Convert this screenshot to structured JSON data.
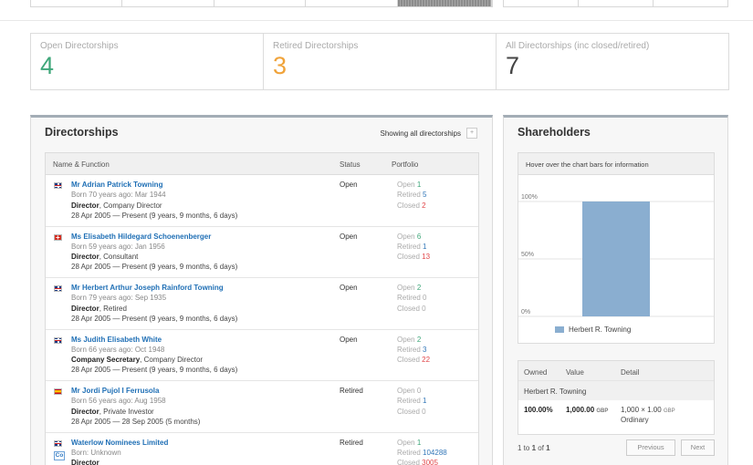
{
  "stats": [
    {
      "label": "Open Directorships",
      "value": "4",
      "color": "#3fa77a"
    },
    {
      "label": "Retired Directorships",
      "value": "3",
      "color": "#f0a33a"
    },
    {
      "label": "All Directorships (inc closed/retired)",
      "value": "7",
      "color": "#444444"
    }
  ],
  "directorships": {
    "title": "Directorships",
    "showing": "Showing all directorships",
    "showing_btn": "+",
    "columns": {
      "name": "Name & Function",
      "status": "Status",
      "portfolio": "Portfolio"
    },
    "rows": [
      {
        "flag": "uk",
        "name": "Mr Adrian Patrick Towning",
        "born": "Born 70 years ago: Mar 1944",
        "role": "Director",
        "occupation": ", Company Director",
        "dates": "28 Apr 2005 — Present (9 years, 9 months, 6 days)",
        "status": "Open",
        "open_label": "Open",
        "open": "1",
        "retired_label": "Retired",
        "retired": "5",
        "closed_label": "Closed",
        "closed": "2"
      },
      {
        "flag": "ch",
        "name": "Ms Elisabeth Hildegard Schoenenberger",
        "born": "Born 59 years ago: Jan 1956",
        "role": "Director",
        "occupation": ", Consultant",
        "dates": "28 Apr 2005 — Present (9 years, 9 months, 6 days)",
        "status": "Open",
        "open_label": "Open",
        "open": "6",
        "retired_label": "Retired",
        "retired": "1",
        "closed_label": "Closed",
        "closed": "13"
      },
      {
        "flag": "uk",
        "name": "Mr Herbert Arthur Joseph Rainford Towning",
        "born": "Born 79 years ago: Sep 1935",
        "role": "Director",
        "occupation": ", Retired",
        "dates": "28 Apr 2005 — Present (9 years, 9 months, 6 days)",
        "status": "Open",
        "open_label": "Open",
        "open": "2",
        "retired_label": "Retired",
        "retired": "0",
        "closed_label": "Closed",
        "closed": "0"
      },
      {
        "flag": "uk",
        "name": "Ms Judith Elisabeth White",
        "born": "Born 66 years ago: Oct 1948",
        "role": "Company Secretary",
        "occupation": ", Company Director",
        "dates": "28 Apr 2005 — Present (9 years, 9 months, 6 days)",
        "status": "Open",
        "open_label": "Open",
        "open": "2",
        "retired_label": "Retired",
        "retired": "3",
        "closed_label": "Closed",
        "closed": "22"
      },
      {
        "flag": "es",
        "name": "Mr Jordi Pujol I Ferrusola",
        "born": "Born 56 years ago: Aug 1958",
        "role": "Director",
        "occupation": ", Private Investor",
        "dates": "28 Apr 2005 — 28 Sep 2005 (5 months)",
        "status": "Retired",
        "open_label": "Open",
        "open": "0",
        "retired_label": "Retired",
        "retired": "1",
        "closed_label": "Closed",
        "closed": "0"
      },
      {
        "flag": "uk",
        "company": true,
        "company_icon": "Co",
        "name": "Waterlow Nominees Limited",
        "born": "Born: Unknown",
        "role": "Director",
        "occupation": "",
        "dates": "",
        "status": "Retired",
        "open_label": "Open",
        "open": "1",
        "retired_label": "Retired",
        "retired": "104288",
        "closed_label": "Closed",
        "closed": "3005"
      }
    ]
  },
  "shareholders": {
    "title": "Shareholders",
    "hint": "Hover over the chart bars for information",
    "chart_data": {
      "type": "bar",
      "categories": [
        "Herbert R. Towning"
      ],
      "values": [
        100
      ],
      "ylim": [
        0,
        100
      ],
      "ytick_labels": [
        "100%",
        "50%",
        "0%"
      ],
      "series": [
        {
          "name": "Herbert R. Towning",
          "values": [
            100
          ]
        }
      ],
      "bar_color": "#8aaed0",
      "legend": "bottom"
    },
    "table": {
      "headers": {
        "owned": "Owned",
        "value": "Value",
        "detail": "Detail"
      },
      "holder": "Herbert R. Towning",
      "owned": "100.00%",
      "value": "1,000.00",
      "value_currency": "GBP",
      "detail_line1": "1,000 × 1.00",
      "detail_currency": "GBP",
      "detail_line2": "Ordinary"
    },
    "pager": {
      "info_pre": "1 to ",
      "info_from": "1",
      "info_mid": " of ",
      "info_total": "1",
      "previous": "Previous",
      "next": "Next"
    }
  }
}
